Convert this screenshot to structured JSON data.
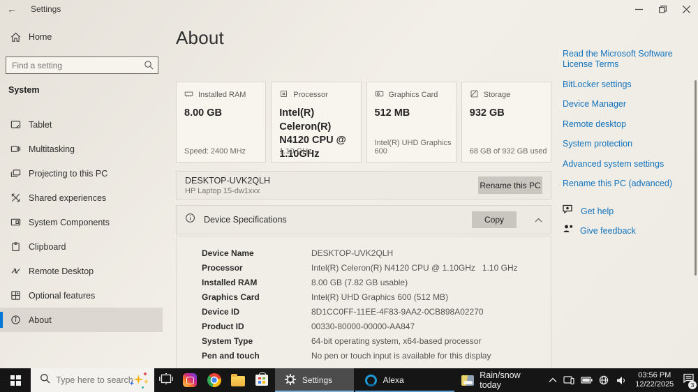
{
  "window": {
    "title": "Settings"
  },
  "sidebar": {
    "home_label": "Home",
    "search_placeholder": "Find a setting",
    "section_label": "System",
    "items": [
      {
        "label": "Tablet"
      },
      {
        "label": "Multitasking"
      },
      {
        "label": "Projecting to this PC"
      },
      {
        "label": "Shared experiences"
      },
      {
        "label": "System Components"
      },
      {
        "label": "Clipboard"
      },
      {
        "label": "Remote Desktop"
      },
      {
        "label": "Optional features"
      },
      {
        "label": "About"
      }
    ]
  },
  "main": {
    "page_title": "About",
    "cards": [
      {
        "label": "Installed RAM",
        "value": "8.00 GB",
        "footer": "Speed: 2400 MHz"
      },
      {
        "label": "Processor",
        "value": "Intel(R) Celeron(R) N4120 CPU @ 1.10GHz",
        "footer": "1.10 GHz"
      },
      {
        "label": "Graphics Card",
        "value": "512 MB",
        "footer": "Intel(R) UHD Graphics 600"
      },
      {
        "label": "Storage",
        "value": "932 GB",
        "footer": "68 GB of 932 GB used"
      }
    ],
    "device": {
      "name": "DESKTOP-UVK2QLH",
      "model": "HP Laptop 15-dw1xxx",
      "rename_button": "Rename this PC"
    },
    "specs": {
      "title": "Device Specifications",
      "copy_button": "Copy",
      "rows": [
        {
          "label": "Device Name",
          "value": "DESKTOP-UVK2QLH"
        },
        {
          "label": "Processor",
          "value": "Intel(R) Celeron(R) N4120 CPU @ 1.10GHz   1.10 GHz"
        },
        {
          "label": "Installed RAM",
          "value": "8.00 GB (7.82 GB usable)"
        },
        {
          "label": "Graphics Card",
          "value": "Intel(R) UHD Graphics 600 (512 MB)"
        },
        {
          "label": "Device ID",
          "value": "8D1CC0FF-11EE-4F83-9AA2-0CB898A02270"
        },
        {
          "label": "Product ID",
          "value": "00330-80000-00000-AA847"
        },
        {
          "label": "System Type",
          "value": "64-bit operating system, x64-based processor"
        },
        {
          "label": "Pen and touch",
          "value": "No pen or touch input is available for this display"
        }
      ]
    }
  },
  "related": {
    "links": [
      "Read the Microsoft Software License Terms",
      "BitLocker settings",
      "Device Manager",
      "Remote desktop",
      "System protection",
      "Advanced system settings",
      "Rename this PC (advanced)"
    ],
    "help": [
      {
        "label": "Get help"
      },
      {
        "label": "Give feedback"
      }
    ]
  },
  "taskbar": {
    "search_placeholder": "Type here to search",
    "settings_app_label": "Settings",
    "alexa_label": "Alexa",
    "weather_label": "Rain/snow today",
    "clock_time": "03:56 PM",
    "clock_date": "12/22/2025",
    "notification_count": "3"
  },
  "colors": {
    "accent": "#0078d7",
    "link": "#1473bd",
    "taskbar": "#151515",
    "button_gray": "#c9c5bf"
  }
}
